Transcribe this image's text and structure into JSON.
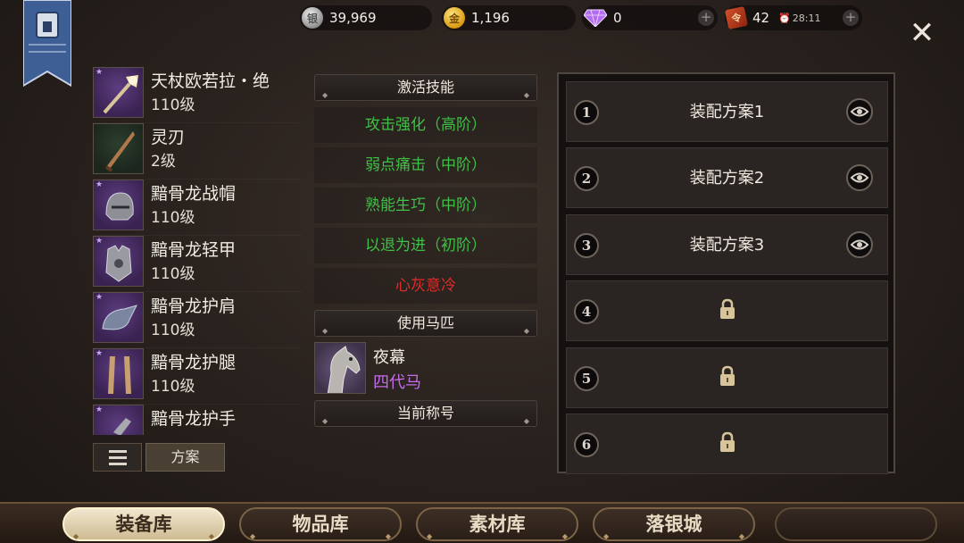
{
  "currencies": [
    {
      "name": "silver",
      "icon": "silver-coin-icon",
      "value": "39,969"
    },
    {
      "name": "gold",
      "icon": "gold-coin-icon",
      "value": "1,196"
    },
    {
      "name": "diamond",
      "icon": "diamond-icon",
      "value": "0"
    },
    {
      "name": "stamina",
      "icon": "ticket-icon",
      "value": "42",
      "timer": "28:11"
    }
  ],
  "equipment": [
    {
      "name": "天杖欧若拉・绝",
      "level": "110级",
      "rarity": "purple"
    },
    {
      "name": "灵刃",
      "level": "2级",
      "rarity": "green"
    },
    {
      "name": "黯骨龙战帽",
      "level": "110级",
      "rarity": "purple"
    },
    {
      "name": "黯骨龙轻甲",
      "level": "110级",
      "rarity": "purple"
    },
    {
      "name": "黯骨龙护肩",
      "level": "110级",
      "rarity": "purple"
    },
    {
      "name": "黯骨龙护腿",
      "level": "110级",
      "rarity": "purple"
    },
    {
      "name": "黯骨龙护手",
      "level": "",
      "rarity": "purple"
    }
  ],
  "list_controls": {
    "plan_label": "方案"
  },
  "skills": {
    "header": "激活技能",
    "items": [
      {
        "label": "攻击强化（高阶）",
        "color": "#3fc046"
      },
      {
        "label": "弱点痛击（中阶）",
        "color": "#3fc046"
      },
      {
        "label": "熟能生巧（中阶）",
        "color": "#3fc046"
      },
      {
        "label": "以退为进（初阶）",
        "color": "#3fc046"
      },
      {
        "label": "心灰意冷",
        "color": "#e02a2a"
      }
    ]
  },
  "mount": {
    "header": "使用马匹",
    "name": "夜幕",
    "generation": "四代马"
  },
  "title_section": {
    "header": "当前称号"
  },
  "loadouts": [
    {
      "num": "1",
      "label": "装配方案1",
      "locked": false
    },
    {
      "num": "2",
      "label": "装配方案2",
      "locked": false
    },
    {
      "num": "3",
      "label": "装配方案3",
      "locked": false
    },
    {
      "num": "4",
      "label": "",
      "locked": true
    },
    {
      "num": "5",
      "label": "",
      "locked": true
    },
    {
      "num": "6",
      "label": "",
      "locked": true
    }
  ],
  "tabs": [
    {
      "label": "装备库",
      "active": true
    },
    {
      "label": "物品库",
      "active": false
    },
    {
      "label": "素材库",
      "active": false
    },
    {
      "label": "落银城",
      "active": false
    }
  ],
  "close_icon": "close-icon"
}
